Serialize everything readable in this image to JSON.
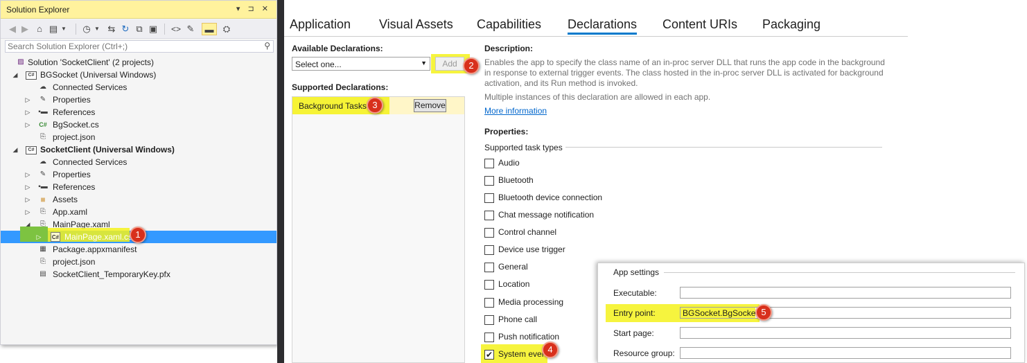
{
  "solution_explorer": {
    "title": "Solution Explorer",
    "title_buttons": "▾ ⊐ ✕",
    "search_placeholder": "Search Solution Explorer (Ctrl+;)",
    "tree": [
      {
        "label": "Solution 'SocketClient' (2 projects)",
        "icon": "solution-icon",
        "bold": false
      },
      {
        "label": "BGSocket (Universal Windows)",
        "icon": "csharp-project-icon",
        "bold": false
      },
      {
        "label": "Connected Services",
        "icon": "cloud-icon",
        "bold": false
      },
      {
        "label": "Properties",
        "icon": "wrench-icon",
        "bold": false
      },
      {
        "label": "References",
        "icon": "references-icon",
        "bold": false
      },
      {
        "label": "BgSocket.cs",
        "icon": "csharp-file-icon",
        "bold": false
      },
      {
        "label": "project.json",
        "icon": "json-file-icon",
        "bold": false
      },
      {
        "label": "SocketClient (Universal Windows)",
        "icon": "csharp-project-icon",
        "bold": true
      },
      {
        "label": "Connected Services",
        "icon": "cloud-icon",
        "bold": false
      },
      {
        "label": "Properties",
        "icon": "wrench-icon",
        "bold": false
      },
      {
        "label": "References",
        "icon": "references-icon",
        "bold": false
      },
      {
        "label": "Assets",
        "icon": "folder-icon",
        "bold": false
      },
      {
        "label": "App.xaml",
        "icon": "xaml-file-icon",
        "bold": false
      },
      {
        "label": "MainPage.xaml",
        "icon": "xaml-file-icon",
        "bold": false
      },
      {
        "label": "MainPage.xaml.cs",
        "icon": "csharp-file-icon",
        "bold": false
      },
      {
        "label": "Package.appxmanifest",
        "icon": "manifest-icon",
        "bold": false
      },
      {
        "label": "project.json",
        "icon": "json-file-icon",
        "bold": false
      },
      {
        "label": "SocketClient_TemporaryKey.pfx",
        "icon": "certificate-icon",
        "bold": false
      }
    ]
  },
  "tabs": [
    "Application",
    "Visual Assets",
    "Capabilities",
    "Declarations",
    "Content URIs",
    "Packaging"
  ],
  "active_tab": "Declarations",
  "declarations": {
    "available_label": "Available Declarations:",
    "select_value": "Select one...",
    "add_label": "Add",
    "supported_label": "Supported Declarations:",
    "supported_item": "Background Tasks",
    "remove_label": "Remove"
  },
  "description": {
    "heading": "Description:",
    "line1": "Enables the app to specify the class name of an in-proc server DLL that runs the app code in the background",
    "line2": "in response to external trigger events. The class hosted in the in-proc server DLL is activated for background",
    "line3": "activation, and its Run method is invoked.",
    "multiple": "Multiple instances of this declaration are allowed in each app.",
    "more_info": "More information"
  },
  "properties": {
    "heading": "Properties:",
    "task_types_label": "Supported task types",
    "task_types": [
      {
        "label": "Audio",
        "checked": false
      },
      {
        "label": "Bluetooth",
        "checked": false
      },
      {
        "label": "Bluetooth device connection",
        "checked": false
      },
      {
        "label": "Chat message notification",
        "checked": false
      },
      {
        "label": "Control channel",
        "checked": false
      },
      {
        "label": "Device use trigger",
        "checked": false
      },
      {
        "label": "General",
        "checked": false
      },
      {
        "label": "Location",
        "checked": false
      },
      {
        "label": "Media processing",
        "checked": false
      },
      {
        "label": "Phone call",
        "checked": false
      },
      {
        "label": "Push notification",
        "checked": false
      },
      {
        "label": "System event",
        "checked": true
      }
    ]
  },
  "app_settings": {
    "title": "App settings",
    "executable_label": "Executable:",
    "executable_value": "",
    "entry_point_label": "Entry point:",
    "entry_point_value": "BGSocket.BgSocket",
    "start_page_label": "Start page:",
    "start_page_value": "",
    "resource_group_label": "Resource group:",
    "resource_group_value": ""
  },
  "callouts": [
    "1",
    "2",
    "3",
    "4",
    "5"
  ],
  "colors": {
    "highlight_yellow": "#f4f21c",
    "highlight_green": "#7dc341",
    "selection_blue": "#3399ff",
    "callout_red": "#d8301c",
    "link_blue": "#0066cc",
    "tab_underline": "#007acc"
  }
}
